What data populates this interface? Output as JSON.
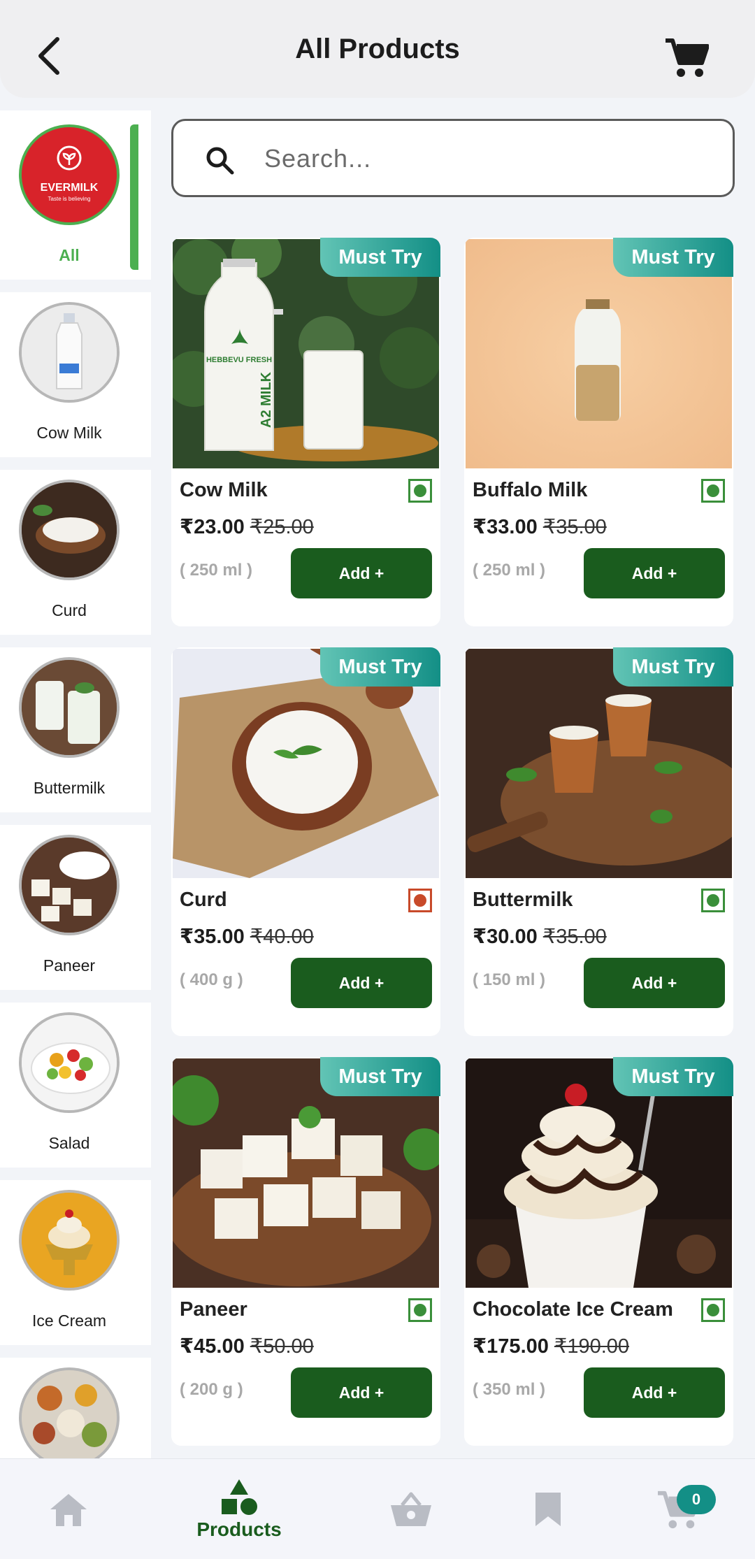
{
  "header": {
    "title": "All Products"
  },
  "search": {
    "placeholder": "Search..."
  },
  "categories": [
    {
      "label": "All",
      "brand": "EVERMILK",
      "tagline": "Taste is believing"
    },
    {
      "label": "Cow Milk"
    },
    {
      "label": "Curd"
    },
    {
      "label": "Buttermilk"
    },
    {
      "label": "Paneer"
    },
    {
      "label": "Salad"
    },
    {
      "label": "Ice Cream"
    }
  ],
  "badge_text": "Must Try",
  "add_label": "Add +",
  "products": [
    {
      "name": "Cow Milk",
      "price": "₹23.00",
      "mrp": "₹25.00",
      "qty": "( 250 ml )",
      "diet": "veg",
      "bottle_text": "HEBBEVU FRESH",
      "bottle_side": "A2 MILK"
    },
    {
      "name": "Buffalo Milk",
      "price": "₹33.00",
      "mrp": "₹35.00",
      "qty": "( 250 ml )",
      "diet": "veg"
    },
    {
      "name": "Curd",
      "price": "₹35.00",
      "mrp": "₹40.00",
      "qty": "( 400 g )",
      "diet": "non-veg"
    },
    {
      "name": "Buttermilk",
      "price": "₹30.00",
      "mrp": "₹35.00",
      "qty": "( 150 ml )",
      "diet": "veg"
    },
    {
      "name": "Paneer",
      "price": "₹45.00",
      "mrp": "₹50.00",
      "qty": "( 200 g )",
      "diet": "veg"
    },
    {
      "name": "Chocolate Ice Cream",
      "price": "₹175.00",
      "mrp": "₹190.00",
      "qty": "( 350 ml )",
      "diet": "veg"
    }
  ],
  "bottom_nav": {
    "items": [
      {
        "icon": "home-icon"
      },
      {
        "icon": "shapes-icon",
        "label": "Products"
      },
      {
        "icon": "basket-icon"
      },
      {
        "icon": "bookmark-icon"
      },
      {
        "icon": "cart-icon"
      }
    ],
    "cart_count": "0"
  },
  "colors": {
    "accent": "#1a5c1e",
    "active": "#4caf50",
    "badge": "#138f86"
  }
}
